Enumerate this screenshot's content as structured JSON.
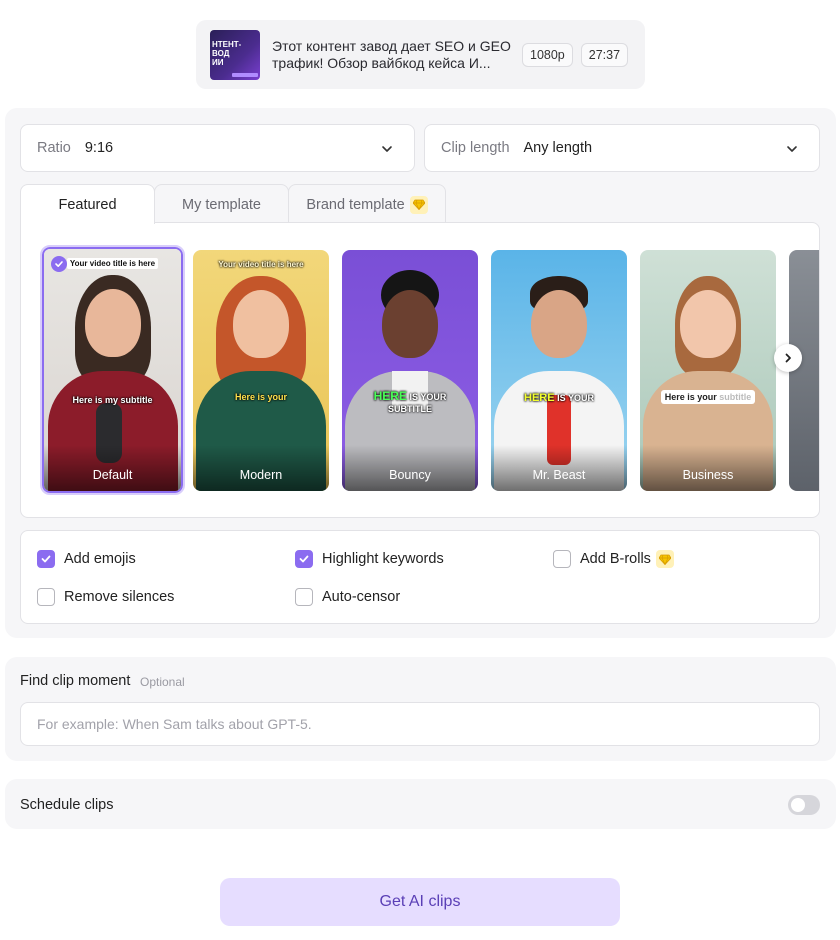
{
  "video": {
    "thumb_text": "НТЕНТ-\nВОД\nИИ",
    "title": "Этот контент завод дает SEO и GEO трафик! Обзор вайбкод кейса И...",
    "resolution": "1080p",
    "duration": "27:37"
  },
  "ratio": {
    "label": "Ratio",
    "value": "9:16"
  },
  "clip_length": {
    "label": "Clip length",
    "value": "Any length"
  },
  "tabs": [
    {
      "label": "Featured",
      "active": true
    },
    {
      "label": "My template",
      "active": false
    },
    {
      "label": "Brand template",
      "active": false,
      "premium": true
    }
  ],
  "templates": [
    {
      "name": "Default",
      "selected": true,
      "title_caption": "Your video title is here",
      "subtitle_caption": "Here is my subtitle"
    },
    {
      "name": "Modern",
      "selected": false,
      "title_caption": "Your video title is here",
      "subtitle_caption": "Here is your"
    },
    {
      "name": "Bouncy",
      "selected": false,
      "subtitle_highlight": "HERE",
      "subtitle_caption": "IS YOUR",
      "subtitle_caption2": "SUBTITLE"
    },
    {
      "name": "Mr. Beast",
      "selected": false,
      "subtitle_highlight": "HERE",
      "subtitle_caption": "IS YOUR"
    },
    {
      "name": "Business",
      "selected": false,
      "subtitle_caption": "Here is your",
      "subtitle_faded": "subtitle"
    }
  ],
  "options": [
    {
      "label": "Add emojis",
      "checked": true
    },
    {
      "label": "Highlight keywords",
      "checked": true
    },
    {
      "label": "Add B-rolls",
      "checked": false,
      "premium": true
    },
    {
      "label": "Remove silences",
      "checked": false
    },
    {
      "label": "Auto-censor",
      "checked": false
    }
  ],
  "find_clip": {
    "title": "Find clip moment",
    "optional": "Optional",
    "placeholder": "For example: When Sam talks about GPT-5."
  },
  "schedule": {
    "label": "Schedule clips",
    "enabled": false
  },
  "cta": {
    "label": "Get AI clips"
  },
  "colors": {
    "accent": "#8b6cf0",
    "cta_bg": "#e6ddff",
    "cta_text": "#5a3fb6",
    "premium": "#f5c400"
  }
}
